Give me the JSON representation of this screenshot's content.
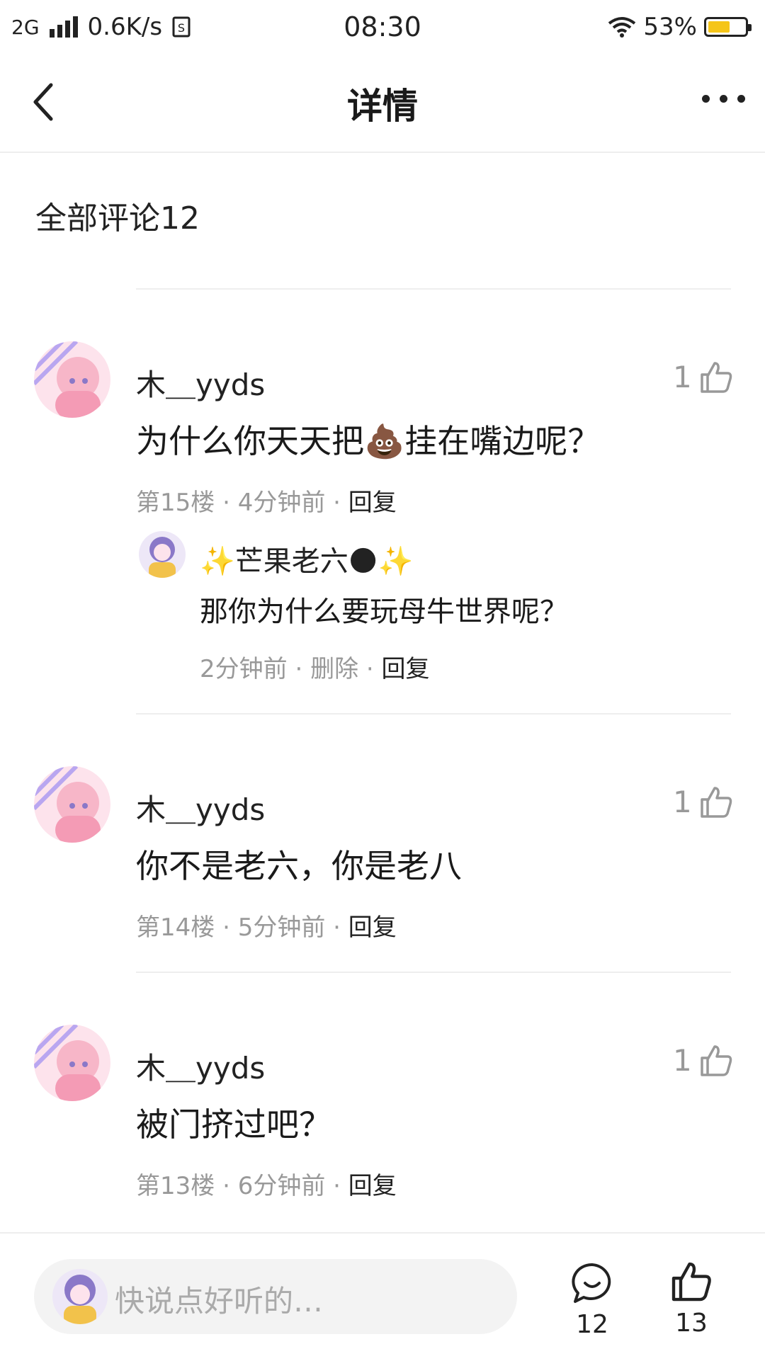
{
  "status_bar": {
    "network": "2G",
    "speed": "0.6K/s",
    "time": "08:30",
    "battery": "53%"
  },
  "header": {
    "title": "详情"
  },
  "section": {
    "all_comments": "全部评论12"
  },
  "comments": [
    {
      "name": "木＿yyds",
      "likes": "1",
      "text_before": "为什么你天天把",
      "emoji": "💩",
      "text_after": "挂在嘴边呢？",
      "floor": "第15楼",
      "time": "4分钟前",
      "reply_label": "回复",
      "reply": {
        "name": "✨芒果老六🌑✨",
        "text": "那你为什么要玩母牛世界呢？",
        "time": "2分钟前",
        "delete_label": "删除",
        "reply_label": "回复"
      }
    },
    {
      "name": "木＿yyds",
      "likes": "1",
      "text": "你不是老六，你是老八",
      "floor": "第14楼",
      "time": "5分钟前",
      "reply_label": "回复"
    },
    {
      "name": "木＿yyds",
      "likes": "1",
      "text": "被门挤过吧？",
      "floor": "第13楼",
      "time": "6分钟前",
      "reply_label": "回复"
    }
  ],
  "bottom_bar": {
    "placeholder": "快说点好听的…",
    "comment_count": "12",
    "like_count": "13"
  },
  "colors": {
    "avatar_pink": "#f7b6c8",
    "avatar_purple": "#8a78c8",
    "battery_fill": "#f5c518"
  },
  "icons": [
    "back-arrow-icon",
    "more-icon",
    "thumbs-up-icon",
    "comment-bubble-icon",
    "sparkle-icon",
    "new-moon-icon"
  ]
}
